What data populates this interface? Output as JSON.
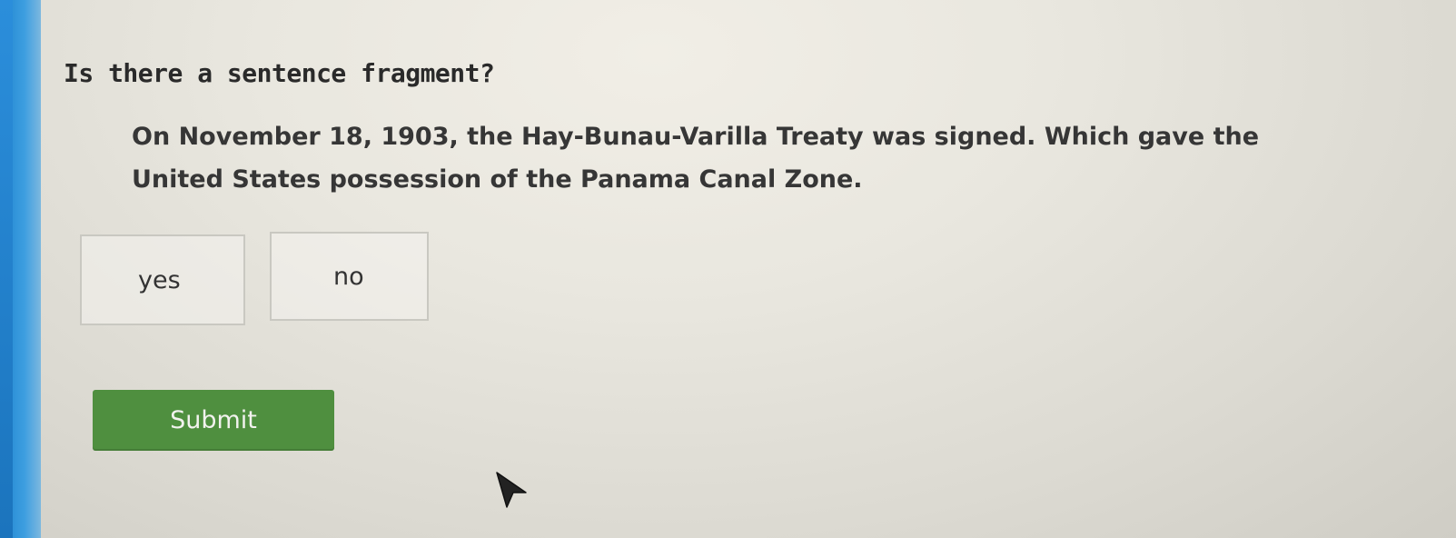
{
  "question": {
    "title": "Is there a sentence fragment?"
  },
  "passage": {
    "text": "On November 18, 1903, the Hay-Bunau-Varilla Treaty was signed. Which gave the United States possession of the Panama Canal Zone."
  },
  "choices": [
    {
      "label": "yes"
    },
    {
      "label": "no"
    }
  ],
  "submit": {
    "label": "Submit"
  },
  "colors": {
    "submit_button": "#4f8f3f",
    "left_panel": "#2b8edb"
  },
  "icons": {
    "pointer": "mouse-pointer-icon"
  }
}
